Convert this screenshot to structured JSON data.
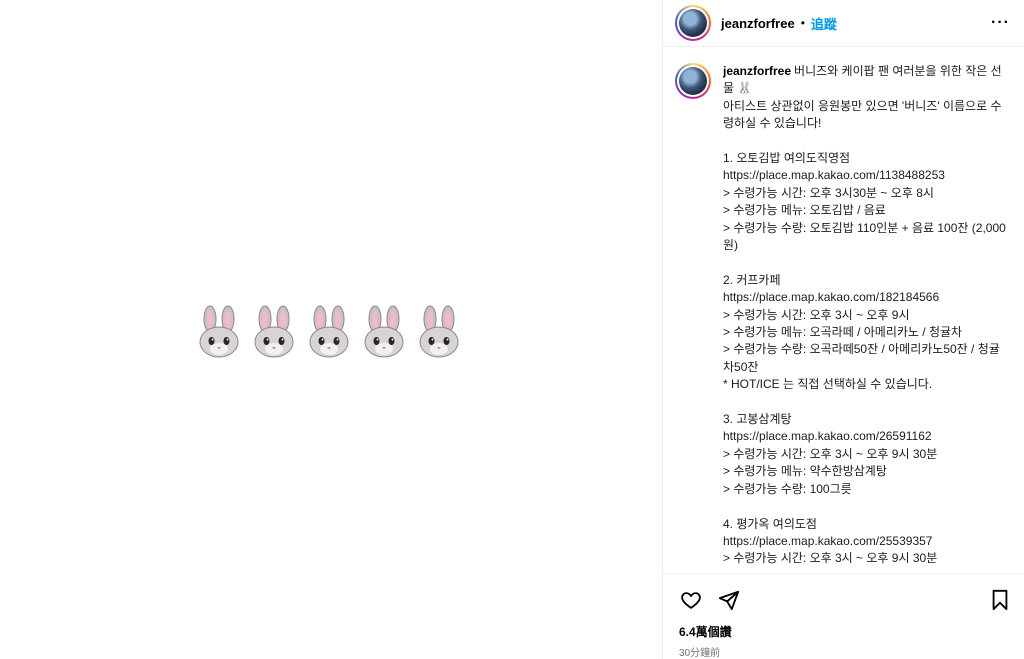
{
  "post": {
    "username": "jeanzforfree",
    "follow_label": "追蹤",
    "more_icon": "more-horizontal-icon",
    "caption_username": "jeanzforfree",
    "caption_lines": [
      "버니즈와 케이팝 팬 여러분을 위한 작은 선물 🐰",
      "아티스트 상관없이 응원봉만 있으면 '버니즈' 이름으로 수령하실 수 있습니다!",
      "",
      "1. 오토김밥 여의도직영점",
      "https://place.map.kakao.com/1138488253",
      "> 수령가능 시간: 오후 3시30분 ~ 오후 8시",
      "> 수령가능 메뉴: 오토김밥 / 음료",
      "> 수령가능 수량: 오토김밥 110인분 + 음료 100잔 (2,000원)",
      "",
      "2. 커프카페",
      "https://place.map.kakao.com/182184566",
      "> 수령가능 시간: 오후 3시 ~ 오후 9시",
      "> 수령가능 메뉴: 오곡라떼 / 아메리카노 / 청귤차",
      "> 수령가능 수량: 오곡라떼50잔 / 아메리카노50잔 / 청귤차50잔",
      "* HOT/ICE 는 직접 선택하실 수 있습니다.",
      "",
      "3. 고봉삼계탕",
      "https://place.map.kakao.com/26591162",
      "> 수령가능 시간: 오후 3시 ~ 오후 9시 30분",
      "> 수령가능 메뉴: 약수한방삼계탕",
      "> 수령가능 수량: 100그릇",
      "",
      "4. 평가옥 여의도점",
      "https://place.map.kakao.com/25539357",
      "> 수령가능 시간: 오후 3시 ~ 오후 9시 30분"
    ],
    "likes": "6.4萬個讚",
    "time": "30分鐘前",
    "media_emoji_count": 5
  },
  "colors": {
    "follow": "#0095f6",
    "muted": "#737373",
    "border": "#efefef"
  }
}
